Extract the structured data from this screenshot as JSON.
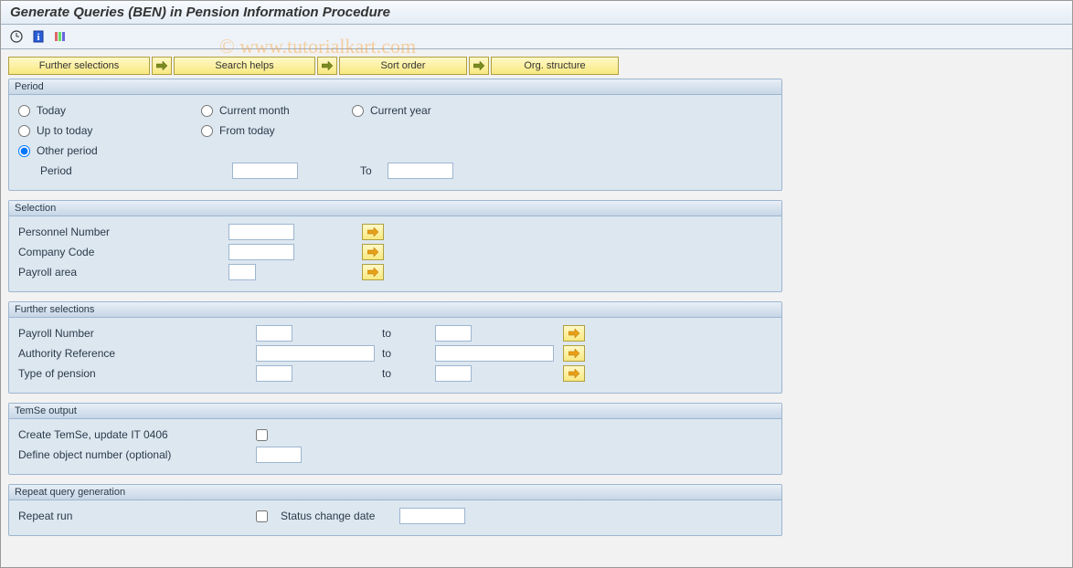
{
  "title": "Generate Queries (BEN) in Pension Information Procedure",
  "watermark": "© www.tutorialkart.com",
  "toolbar_buttons": {
    "further_selections": "Further selections",
    "search_helps": "Search helps",
    "sort_order": "Sort order",
    "org_structure": "Org. structure"
  },
  "period": {
    "title": "Period",
    "today": "Today",
    "current_month": "Current month",
    "current_year": "Current year",
    "up_to_today": "Up to today",
    "from_today": "From today",
    "other_period": "Other period",
    "period_label": "Period",
    "to_label": "To"
  },
  "selection": {
    "title": "Selection",
    "personnel_number": "Personnel Number",
    "company_code": "Company Code",
    "payroll_area": "Payroll area"
  },
  "further": {
    "title": "Further selections",
    "payroll_number": "Payroll Number",
    "authority_reference": "Authority Reference",
    "type_of_pension": "Type of pension",
    "to": "to"
  },
  "temse": {
    "title": "TemSe output",
    "create": "Create TemSe, update IT 0406",
    "define": "Define object number (optional)"
  },
  "repeat": {
    "title": "Repeat query generation",
    "repeat_run": "Repeat run",
    "status_change_date": "Status change date"
  }
}
